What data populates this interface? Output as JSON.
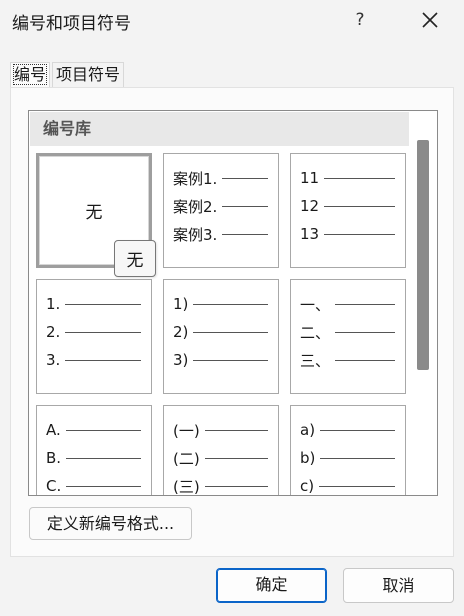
{
  "window": {
    "title": "编号和项目符号",
    "help_label": "?",
    "close_icon": "close-icon"
  },
  "tabs": [
    {
      "label": "编号",
      "active": true
    },
    {
      "label": "项目符号",
      "active": false
    }
  ],
  "gallery": {
    "header": "编号库",
    "tooltip": "无",
    "cells": [
      {
        "type": "none",
        "label": "无",
        "selected": true
      },
      {
        "type": "list",
        "items": [
          "案例1.",
          "案例2.",
          "案例3."
        ]
      },
      {
        "type": "list",
        "items": [
          "11",
          "12",
          "13"
        ]
      },
      {
        "type": "list",
        "items": [
          "1.",
          "2.",
          "3."
        ]
      },
      {
        "type": "list",
        "items": [
          "1)",
          "2)",
          "3)"
        ]
      },
      {
        "type": "list",
        "items": [
          "一、",
          "二、",
          "三、"
        ]
      },
      {
        "type": "list",
        "items": [
          "A.",
          "B.",
          "C."
        ]
      },
      {
        "type": "list",
        "items": [
          "(一)",
          "(二)",
          "(三)"
        ]
      },
      {
        "type": "list",
        "items": [
          "a)",
          "b)",
          "c)"
        ]
      }
    ]
  },
  "buttons": {
    "define_new": "定义新编号格式...",
    "ok": "确定",
    "cancel": "取消"
  },
  "colors": {
    "accent": "#0a64c8",
    "background": "#f3f3f3"
  }
}
